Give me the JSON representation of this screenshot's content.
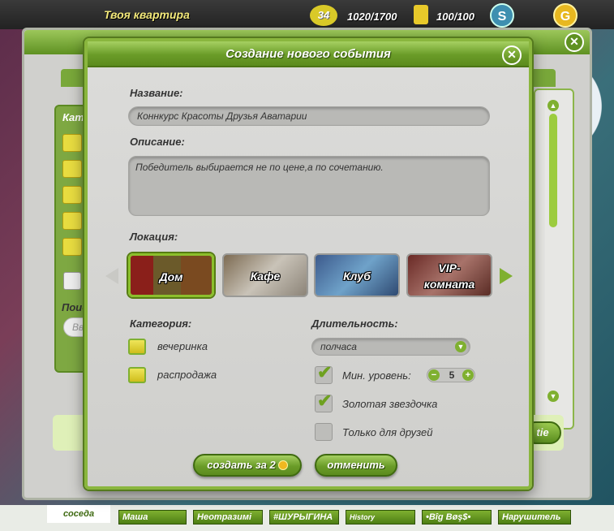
{
  "topbar": {
    "title": "Твоя квартира",
    "level": "34",
    "xp": "1020/1700",
    "energy": "100/100",
    "silver_icon": "S",
    "gold_icon": "G"
  },
  "friends": {
    "neighbor": "соседа",
    "names": [
      "Маша",
      "Неотразимі",
      "#ШУРЫГИНА",
      "History",
      "•Bîg Bøş$•",
      "Нарушитель"
    ]
  },
  "back_dialog": {
    "close_icon": "✕",
    "side_label": "Кат",
    "search_label": "Поис",
    "search_placeholder": "Вв",
    "bottom_button": "tie"
  },
  "dialog": {
    "title": "Создание нового события",
    "close_icon": "✕",
    "name_label": "Название:",
    "name_value": "Коннкурс Красоты Друзья Аватарии",
    "description_label": "Описание:",
    "description_value": "Победитель выбирается не по цене,а по сочетанию.",
    "location_label": "Локация:",
    "locations": [
      {
        "label": "Дом",
        "selected": true
      },
      {
        "label": "Кафе",
        "selected": false
      },
      {
        "label": "Клуб",
        "selected": false
      },
      {
        "label": "VIP-комната",
        "selected": false
      }
    ],
    "category_label": "Категория:",
    "categories": [
      {
        "label": "вечеринка",
        "icon": "cocktail-icon"
      },
      {
        "label": "распродажа",
        "icon": "tag-icon"
      }
    ],
    "duration_label": "Длительность:",
    "duration_value": "полчаса",
    "min_level_label": "Мин. уровень:",
    "min_level_value": "5",
    "min_level_checked": true,
    "gold_star_label": "Золотая звездочка",
    "gold_star_checked": true,
    "friends_only_label": "Только для друзей",
    "friends_only_checked": false,
    "create_button": "создать за 2",
    "cancel_button": "отменить"
  },
  "colors": {
    "accent_green": "#7fb030",
    "header_green": "#6a9c28",
    "dialog_bg": "#d6d6d3"
  }
}
